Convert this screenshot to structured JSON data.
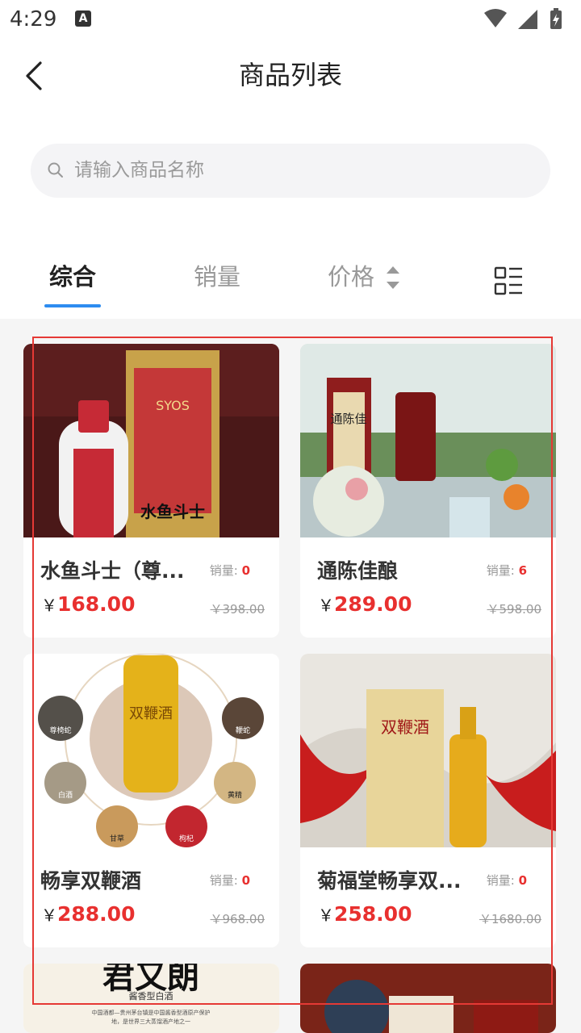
{
  "status_bar": {
    "time": "4:29",
    "a_icon_letter": "A"
  },
  "header": {
    "title": "商品列表"
  },
  "search": {
    "placeholder": "请输入商品名称",
    "value": ""
  },
  "tabs": [
    {
      "label": "综合",
      "active": true
    },
    {
      "label": "销量",
      "active": false
    },
    {
      "label": "价格",
      "active": false
    }
  ],
  "sales_label": "销量:",
  "currency": "￥",
  "products": [
    {
      "name": "水鱼斗士（尊...",
      "sales": "0",
      "price": "168.00",
      "original_price": "￥398.00"
    },
    {
      "name": "通陈佳酿",
      "sales": "6",
      "price": "289.00",
      "original_price": "￥598.00"
    },
    {
      "name": "畅享双鞭酒",
      "sales": "0",
      "price": "288.00",
      "original_price": "￥968.00"
    },
    {
      "name": "菊福堂畅享双...",
      "sales": "0",
      "price": "258.00",
      "original_price": "￥1680.00"
    }
  ],
  "image_text": {
    "p1_brand": "SYOS",
    "p1_label": "水鱼斗士",
    "p2_label": "通陈佳",
    "p3_label": "双鞭酒",
    "p3_ingredients": [
      "尊椅蛇",
      "白酒",
      "甘草",
      "枸杞",
      "黄精",
      "鞭蛇"
    ],
    "p4_label": "双鞭酒",
    "p5_title": "君又朗",
    "p5_sub": "酱香型白酒",
    "p5_desc1": "中国酒都—贵州茅台镇是中国酱香型酒原产保护",
    "p5_desc2": "地，是世界三大蒸馏酒产地之一"
  },
  "colors": {
    "accent": "#2d8cf0",
    "price": "#e8302f",
    "highlight": "#e53935"
  }
}
